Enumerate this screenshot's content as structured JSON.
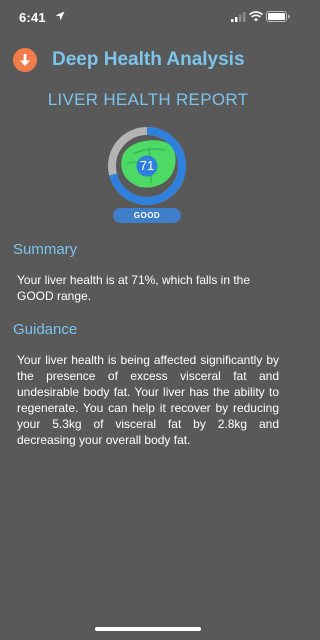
{
  "status_bar": {
    "time": "6:41",
    "location_icon": "location-arrow-icon",
    "signal_icon": "cellular-signal-icon",
    "wifi_icon": "wifi-icon",
    "battery_icon": "battery-icon"
  },
  "header": {
    "back_icon": "arrow-down-icon",
    "title": "Deep Health Analysis"
  },
  "report": {
    "title": "LIVER HEALTH REPORT",
    "gauge": {
      "value": "71",
      "percent": 71,
      "grade": "GOOD",
      "icon": "liver-icon",
      "colors": {
        "track": "#b4b4b4",
        "progress": "#2f80dc",
        "organ": "#4cd964"
      }
    }
  },
  "summary": {
    "heading": "Summary",
    "text": "Your liver health is at 71%, which falls in the GOOD range."
  },
  "guidance": {
    "heading": "Guidance",
    "text": "Your liver health is being affected significantly by the presence of excess visceral fat and undesirable body fat. Your liver has the ability to regenerate. You can help it recover by reducing your 5.3kg of visceral fat by 2.8kg and decreasing your overall body fat."
  },
  "colors": {
    "background": "#595959",
    "accent": "#7cc4ec",
    "back_button": "#f07c4a"
  }
}
